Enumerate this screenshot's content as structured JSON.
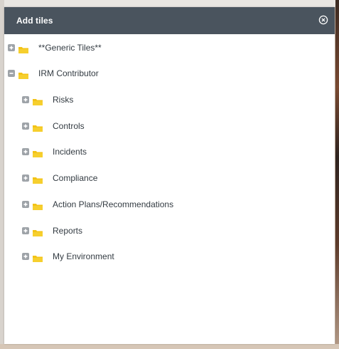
{
  "dialog": {
    "title": "Add tiles",
    "close_icon": "close-circle-icon",
    "header_color": "#4a545e",
    "folder_color": "#f3c316"
  },
  "tree": [
    {
      "label": "**Generic Tiles**",
      "level": 0,
      "state": "collapsed"
    },
    {
      "label": "IRM Contributor",
      "level": 0,
      "state": "expanded"
    },
    {
      "label": "Risks",
      "level": 1,
      "state": "collapsed"
    },
    {
      "label": "Controls",
      "level": 1,
      "state": "collapsed"
    },
    {
      "label": "Incidents",
      "level": 1,
      "state": "collapsed"
    },
    {
      "label": "Compliance",
      "level": 1,
      "state": "collapsed"
    },
    {
      "label": "Action Plans/Recommendations",
      "level": 1,
      "state": "collapsed"
    },
    {
      "label": "Reports",
      "level": 1,
      "state": "collapsed"
    },
    {
      "label": "My Environment",
      "level": 1,
      "state": "collapsed"
    }
  ]
}
